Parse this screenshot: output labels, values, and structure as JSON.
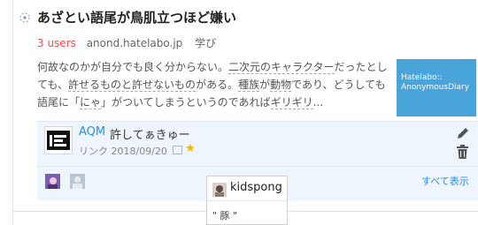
{
  "entry": {
    "title": "あざとい語尾が鳥肌立つほど嫌い",
    "users": "3 users",
    "domain": "anond.hatelabo.jp",
    "category": "学び",
    "summary": {
      "p1": "何故なのかが自分でも良く分からない。",
      "k1": "二次元のキャラクター",
      "p2": "だったとしても、",
      "k2": "許せるものと許せないもの",
      "p3": "がある。",
      "k3": "種族",
      "p4": "が",
      "k4": "動物",
      "p5": "であり、どうしても語尾に「",
      "k5": "にゃ",
      "p6": "」がついてしまうというのであれば",
      "k6": "ギリギリ",
      "p7": "..."
    },
    "thumbnail": {
      "line1": "Hatelabo::",
      "line2": "AnonymousDiary"
    }
  },
  "comment": {
    "user": "AQM",
    "text": "許してぁきゅー",
    "date": "リンク 2018/09/20"
  },
  "stars": {
    "show_all": "すべて表示"
  },
  "popup": {
    "username": "kidspong",
    "comment": "\" 豚 \""
  },
  "colors": {
    "accent": "#2a8ee8",
    "users": "#e84d4d",
    "comment_bg": "#eef5fc",
    "star": "#f2b300"
  }
}
